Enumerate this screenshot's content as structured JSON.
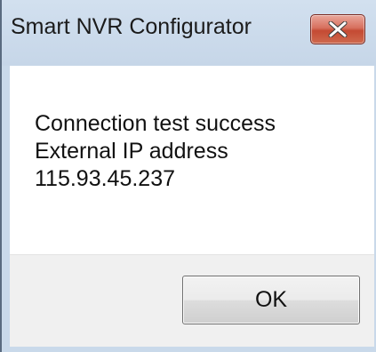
{
  "window": {
    "title": "Smart NVR Configurator",
    "close_icon": "close-x-icon",
    "close_color": "#c44a33"
  },
  "message": {
    "line1": "Connection test success",
    "line2": "External IP address",
    "line3": "115.93.45.237"
  },
  "buttons": {
    "ok_label": "OK"
  }
}
